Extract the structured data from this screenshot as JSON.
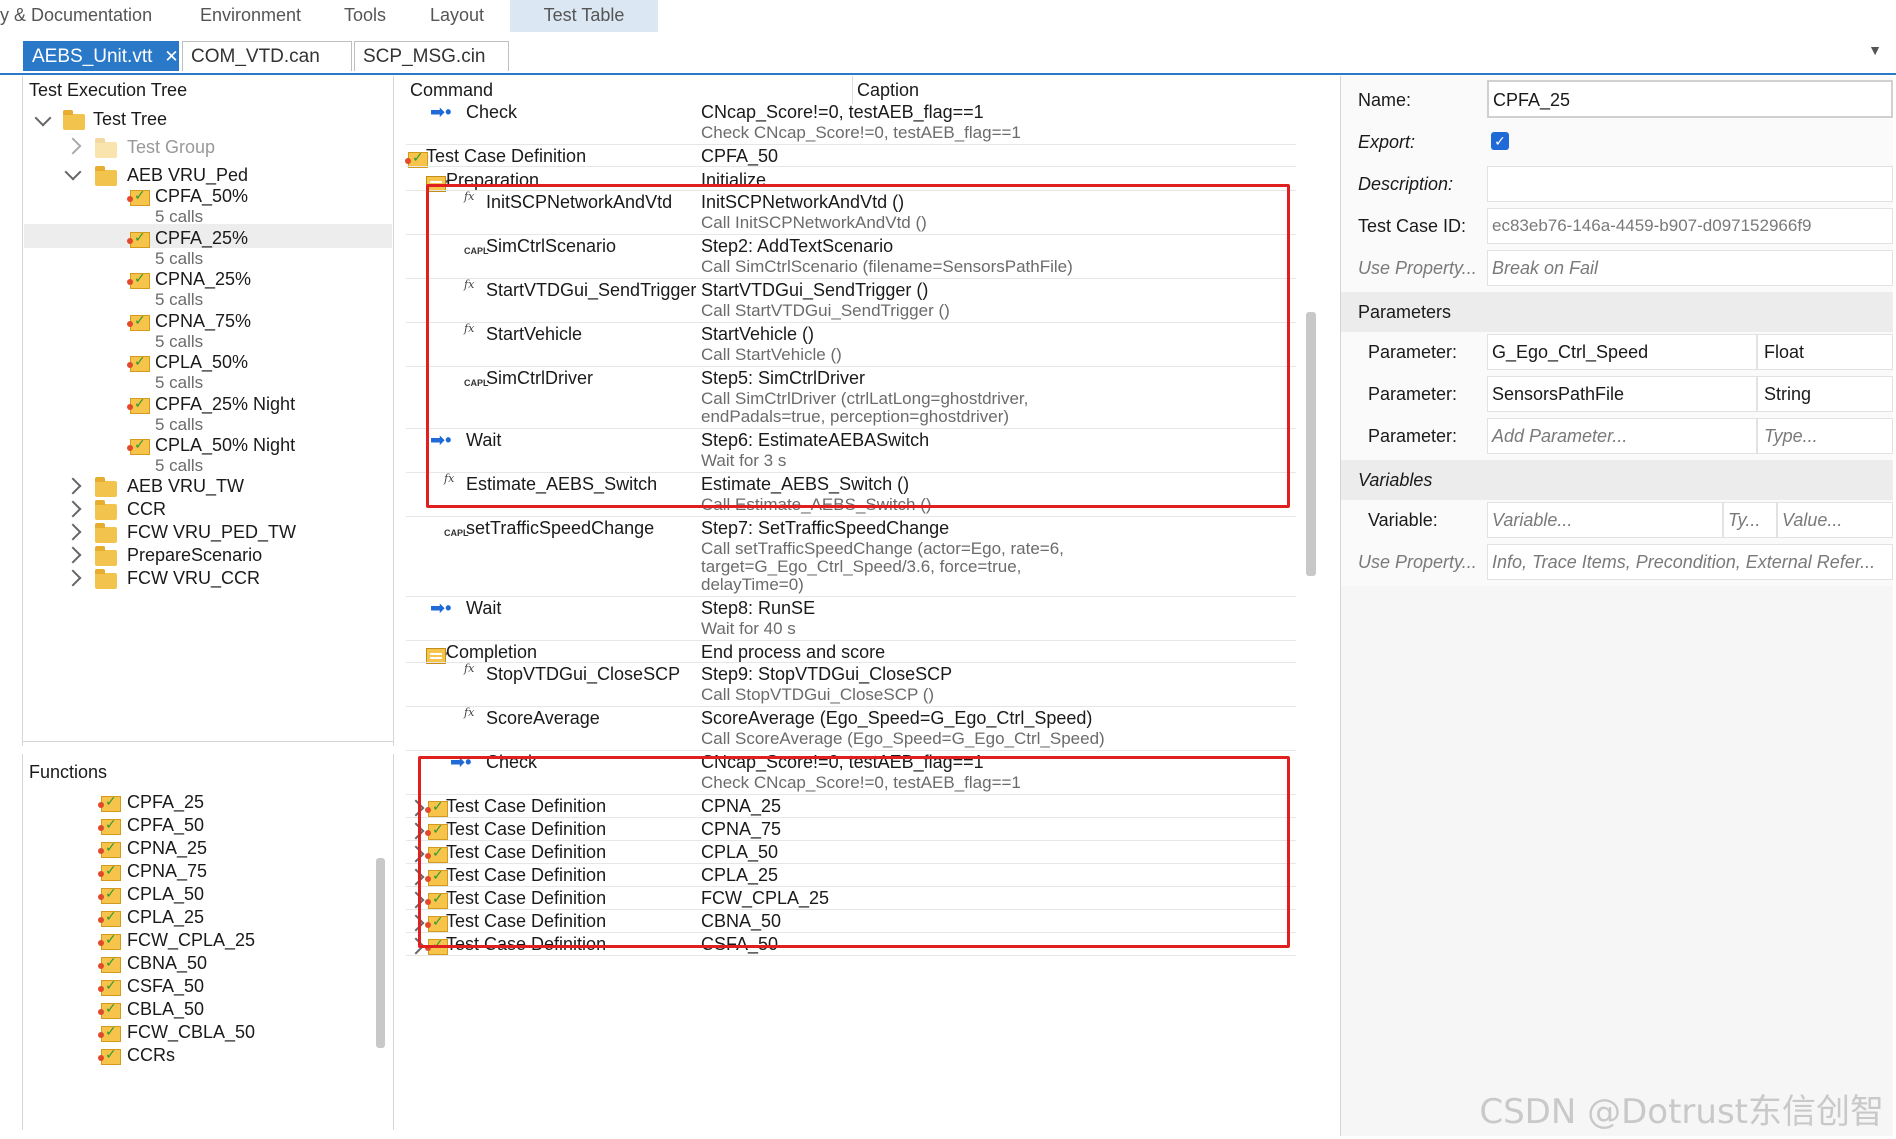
{
  "ribbon": {
    "tabs": [
      "y & Documentation",
      "Environment",
      "Tools",
      "Layout",
      "Test Table"
    ],
    "active": "Test Table"
  },
  "doc_tabs": [
    {
      "label": "AEBS_Unit.vtt",
      "active": true,
      "close": "✕"
    },
    {
      "label": "COM_VTD.can",
      "active": false
    },
    {
      "label": "SCP_MSG.cin",
      "active": false
    }
  ],
  "tree": {
    "header": "Test Execution Tree",
    "root": "Test Tree",
    "group": "Test Group",
    "aeb_ped": "AEB VRU_Ped",
    "cases": [
      {
        "name": "CPFA_50%",
        "calls": "5 calls"
      },
      {
        "name": "CPFA_25%",
        "calls": "5 calls"
      },
      {
        "name": "CPNA_25%",
        "calls": "5 calls"
      },
      {
        "name": "CPNA_75%",
        "calls": "5 calls"
      },
      {
        "name": "CPLA_50%",
        "calls": "5 calls"
      },
      {
        "name": "CPFA_25% Night",
        "calls": "5 calls"
      },
      {
        "name": "CPLA_50% Night",
        "calls": "5 calls"
      }
    ],
    "folders": [
      "AEB VRU_TW",
      "CCR",
      "FCW VRU_PED_TW",
      "PrepareScenario",
      "FCW VRU_CCR"
    ]
  },
  "functions": {
    "header": "Functions",
    "items": [
      "CPFA_25",
      "CPFA_50",
      "CPNA_25",
      "CPNA_75",
      "CPLA_50",
      "CPLA_25",
      "FCW_CPLA_25",
      "CBNA_50",
      "CSFA_50",
      "CBLA_50",
      "FCW_CBLA_50",
      "CCRs"
    ]
  },
  "table": {
    "col_command": "Command",
    "col_caption": "Caption",
    "rows": [
      {
        "cmd": "Check",
        "cap": "CNcap_Score!=0, testAEB_flag==1",
        "cap2": "Check CNcap_Score!=0, testAEB_flag==1"
      },
      {
        "cmd": "Test Case Definition",
        "cap": "CPFA_50"
      },
      {
        "cmd": "Preparation",
        "cap": "Initialize"
      },
      {
        "cmd": "InitSCPNetworkAndVtd",
        "cap": "InitSCPNetworkAndVtd ()",
        "cap2": "Call InitSCPNetworkAndVtd ()"
      },
      {
        "cmd": "SimCtrlScenario",
        "cap": "Step2:  AddTextScenario",
        "cap2": "Call SimCtrlScenario (filename=SensorsPathFile)"
      },
      {
        "cmd": "StartVTDGui_SendTrigger",
        "cap": "StartVTDGui_SendTrigger ()",
        "cap2": "Call StartVTDGui_SendTrigger ()"
      },
      {
        "cmd": "StartVehicle",
        "cap": "StartVehicle ()",
        "cap2": "Call StartVehicle ()"
      },
      {
        "cmd": "SimCtrlDriver",
        "cap": "Step5:  SimCtrlDriver",
        "cap2": "Call SimCtrlDriver (ctrlLatLong=ghostdriver,",
        "cap3": "endPadals=true, perception=ghostdriver)"
      },
      {
        "cmd": "Wait",
        "cap": "Step6:  EstimateAEBASwitch",
        "cap2": "Wait for 3 s"
      },
      {
        "cmd": "Estimate_AEBS_Switch",
        "cap": "Estimate_AEBS_Switch ()",
        "cap2": "Call Estimate_AEBS_Switch ()"
      },
      {
        "cmd": "setTrafficSpeedChange",
        "cap": "Step7:  SetTrafficSpeedChange",
        "cap2": "Call setTrafficSpeedChange (actor=Ego, rate=6,",
        "cap3": "target=G_Ego_Ctrl_Speed/3.6, force=true,",
        "cap4": "delayTime=0)"
      },
      {
        "cmd": "Wait",
        "cap": "Step8:  RunSE",
        "cap2": "Wait for 40 s"
      },
      {
        "cmd": "Completion",
        "cap": "End process  and  score"
      },
      {
        "cmd": "StopVTDGui_CloseSCP",
        "cap": "Step9:  StopVTDGui_CloseSCP",
        "cap2": "Call StopVTDGui_CloseSCP ()"
      },
      {
        "cmd": "ScoreAverage",
        "cap": "ScoreAverage (Ego_Speed=G_Ego_Ctrl_Speed)",
        "cap2": "Call ScoreAverage (Ego_Speed=G_Ego_Ctrl_Speed)"
      },
      {
        "cmd": "Check",
        "cap": "CNcap_Score!=0, testAEB_flag==1",
        "cap2": "Check CNcap_Score!=0, testAEB_flag==1"
      }
    ],
    "tcd": [
      {
        "cmd": "Test Case Definition",
        "cap": "CPNA_25"
      },
      {
        "cmd": "Test Case Definition",
        "cap": "CPNA_75"
      },
      {
        "cmd": "Test Case Definition",
        "cap": "CPLA_50"
      },
      {
        "cmd": "Test Case Definition",
        "cap": "CPLA_25"
      },
      {
        "cmd": "Test Case Definition",
        "cap": "FCW_CPLA_25"
      },
      {
        "cmd": "Test Case Definition",
        "cap": "CBNA_50"
      },
      {
        "cmd": "Test Case Definition",
        "cap": "CSFA_50"
      }
    ],
    "icon_fx": "fx",
    "icon_capl": "CAPL"
  },
  "props": {
    "name_label": "Name:",
    "name_value": "CPFA_25",
    "export_label": "Export:",
    "export_checked": true,
    "desc_label": "Description:",
    "id_label": "Test Case ID:",
    "id_value": "ec83eb76-146a-4459-b907-d097152966f9",
    "useprop_label": "Use Property...",
    "useprop_value": "Break on Fail",
    "params_header": "Parameters",
    "params": [
      {
        "label": "Parameter:",
        "name": "G_Ego_Ctrl_Speed",
        "type": "Float"
      },
      {
        "label": "Parameter:",
        "name": "SensorsPathFile",
        "type": "String"
      },
      {
        "label": "Parameter:",
        "name": "Add Parameter...",
        "type": "Type..."
      }
    ],
    "vars_header": "Variables",
    "var_label": "Variable:",
    "var_name": "Variable...",
    "var_type": "Ty...",
    "var_value": "Value...",
    "useprop2_label": "Use Property...",
    "useprop2_value": "Info, Trace Items, Precondition, External Refer..."
  },
  "watermark": "CSDN @Dotrust东信创智",
  "colors": {
    "accent": "#2a78c8",
    "highlight": "#e0201f"
  }
}
